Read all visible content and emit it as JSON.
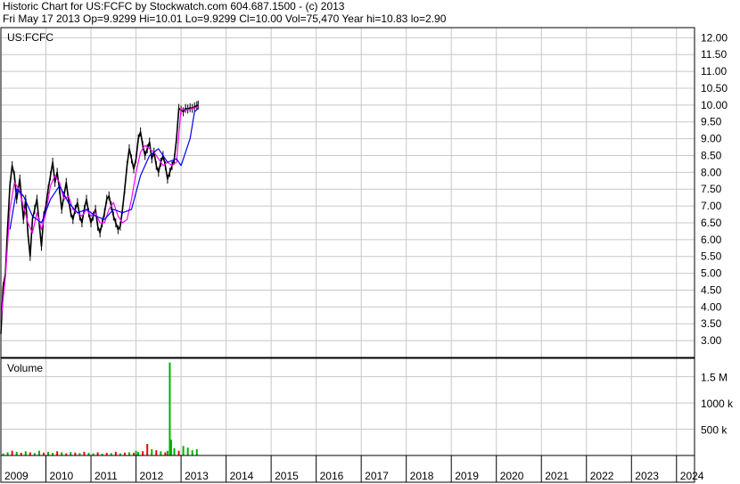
{
  "header": {
    "line1": "Historic Chart for US:FCFC by Stockwatch.com 604.687.1500 - (c) 2013",
    "line2": "Fri May 17 2013   Op=9.9299   Hi=10.01   Lo=9.9299   Cl=10.00   Vol=75,470   Year hi=10.83   lo=2.90"
  },
  "colors": {
    "price_bar": "#000000",
    "ma_short": "#ff00ff",
    "ma_long": "#0000ff",
    "volume_up": "#00b000",
    "volume_down": "#ff0000",
    "grid": "#c8c8c8"
  },
  "chart_data": [
    {
      "type": "line",
      "panel": "price",
      "title": "US:FCFC",
      "ylim": [
        2.5,
        12.3
      ],
      "y_ticks": [
        "12.00",
        "11.50",
        "11.00",
        "10.50",
        "10.00",
        "9.50",
        "9.00",
        "8.50",
        "8.00",
        "7.50",
        "7.00",
        "6.50",
        "6.00",
        "5.50",
        "5.00",
        "4.50",
        "4.00",
        "3.50",
        "3.00"
      ],
      "x_ticks": [
        "2009",
        "2010",
        "2011",
        "2012",
        "2013",
        "2014",
        "2015",
        "2016",
        "2017",
        "2018",
        "2019",
        "2020",
        "2021",
        "2022",
        "2023",
        "2024"
      ],
      "xlim": [
        2009.0,
        2024.4
      ],
      "series": [
        {
          "role": "price",
          "x": [
            2009.0,
            2009.05,
            2009.1,
            2009.15,
            2009.2,
            2009.25,
            2009.3,
            2009.35,
            2009.42,
            2009.5,
            2009.55,
            2009.6,
            2009.65,
            2009.7,
            2009.75,
            2009.8,
            2009.85,
            2009.9,
            2009.95,
            2010.0,
            2010.05,
            2010.1,
            2010.15,
            2010.2,
            2010.25,
            2010.3,
            2010.35,
            2010.4,
            2010.45,
            2010.5,
            2010.55,
            2010.6,
            2010.65,
            2010.7,
            2010.75,
            2010.8,
            2010.85,
            2010.9,
            2010.95,
            2011.0,
            2011.05,
            2011.1,
            2011.15,
            2011.2,
            2011.25,
            2011.3,
            2011.35,
            2011.4,
            2011.45,
            2011.5,
            2011.55,
            2011.6,
            2011.65,
            2011.7,
            2011.75,
            2011.8,
            2011.85,
            2011.9,
            2011.95,
            2012.0,
            2012.05,
            2012.1,
            2012.15,
            2012.2,
            2012.25,
            2012.3,
            2012.35,
            2012.4,
            2012.45,
            2012.5,
            2012.55,
            2012.6,
            2012.65,
            2012.7,
            2012.75,
            2012.8,
            2012.85,
            2012.9,
            2012.95,
            2013.0,
            2013.05,
            2013.1,
            2013.15,
            2013.2,
            2013.25,
            2013.3,
            2013.35,
            2013.38
          ],
          "y": [
            3.2,
            4.6,
            5.0,
            6.4,
            7.6,
            8.2,
            7.9,
            7.2,
            7.8,
            6.6,
            7.2,
            6.2,
            5.5,
            6.6,
            6.9,
            7.2,
            6.5,
            5.8,
            6.7,
            7.0,
            7.5,
            7.9,
            8.3,
            7.7,
            8.0,
            7.5,
            6.9,
            7.3,
            7.7,
            7.2,
            6.8,
            6.6,
            6.9,
            7.1,
            6.7,
            6.5,
            6.9,
            7.2,
            6.8,
            6.5,
            6.7,
            6.9,
            6.4,
            6.2,
            6.5,
            6.8,
            7.2,
            7.3,
            7.0,
            6.7,
            6.5,
            6.3,
            6.4,
            6.9,
            7.5,
            8.2,
            8.7,
            8.4,
            8.1,
            8.4,
            9.0,
            9.2,
            8.8,
            8.5,
            8.7,
            8.9,
            8.4,
            8.6,
            8.2,
            8.0,
            8.3,
            8.5,
            8.2,
            7.8,
            8.0,
            8.2,
            8.4,
            9.0,
            9.9,
            9.85,
            9.8,
            9.9,
            9.88,
            9.92,
            9.9,
            9.95,
            9.98,
            10.0
          ]
        },
        {
          "role": "short moving average",
          "x": [
            2009.0,
            2009.1,
            2009.2,
            2009.3,
            2009.4,
            2009.5,
            2009.6,
            2009.7,
            2009.8,
            2009.9,
            2010.0,
            2010.1,
            2010.2,
            2010.3,
            2010.4,
            2010.5,
            2010.6,
            2010.7,
            2010.8,
            2010.9,
            2011.0,
            2011.1,
            2011.2,
            2011.3,
            2011.4,
            2011.5,
            2011.6,
            2011.7,
            2011.8,
            2011.9,
            2012.0,
            2012.1,
            2012.2,
            2012.3,
            2012.4,
            2012.5,
            2012.6,
            2012.7,
            2012.8,
            2012.9,
            2013.0,
            2013.1,
            2013.2,
            2013.3,
            2013.38
          ],
          "y": [
            3.6,
            4.9,
            6.9,
            7.7,
            7.5,
            7.0,
            6.5,
            6.2,
            6.8,
            6.3,
            6.8,
            7.6,
            7.9,
            7.7,
            7.2,
            7.3,
            6.9,
            6.8,
            6.7,
            6.9,
            6.7,
            6.8,
            6.5,
            6.5,
            6.9,
            7.1,
            6.7,
            6.5,
            6.6,
            7.2,
            8.0,
            8.6,
            8.8,
            8.7,
            8.6,
            8.4,
            8.2,
            8.3,
            8.2,
            8.3,
            9.9,
            9.85,
            9.88,
            9.92,
            9.95
          ]
        },
        {
          "role": "long moving average",
          "x": [
            2009.2,
            2009.35,
            2009.5,
            2009.7,
            2009.9,
            2010.1,
            2010.3,
            2010.5,
            2010.7,
            2010.9,
            2011.1,
            2011.3,
            2011.5,
            2011.7,
            2011.9,
            2012.1,
            2012.3,
            2012.5,
            2012.7,
            2012.9,
            2013.0,
            2013.2,
            2013.3,
            2013.38
          ],
          "y": [
            6.3,
            7.5,
            7.3,
            6.7,
            6.5,
            7.2,
            7.6,
            7.1,
            6.8,
            6.9,
            6.7,
            6.6,
            6.9,
            6.8,
            6.9,
            7.9,
            8.5,
            8.7,
            8.3,
            8.4,
            8.2,
            9.0,
            9.8,
            9.9
          ]
        }
      ]
    },
    {
      "type": "bar",
      "panel": "volume",
      "title": "Volume",
      "ylim": [
        0,
        1850000
      ],
      "y_ticks": [
        {
          "label": "1.5 M",
          "value": 1500000
        },
        {
          "label": "1000 k",
          "value": 1000000
        },
        {
          "label": "500 k",
          "value": 500000
        }
      ],
      "x": [
        2009.05,
        2009.15,
        2009.25,
        2009.35,
        2009.45,
        2009.55,
        2009.65,
        2009.75,
        2009.85,
        2009.95,
        2010.05,
        2010.15,
        2010.25,
        2010.35,
        2010.45,
        2010.55,
        2010.65,
        2010.75,
        2010.85,
        2010.95,
        2011.05,
        2011.15,
        2011.25,
        2011.35,
        2011.45,
        2011.55,
        2011.65,
        2011.75,
        2011.85,
        2011.95,
        2012.0,
        2012.05,
        2012.15,
        2012.25,
        2012.35,
        2012.45,
        2012.55,
        2012.65,
        2012.7,
        2012.75,
        2012.78,
        2012.85,
        2012.95,
        2013.05,
        2013.15,
        2013.25,
        2013.35
      ],
      "values": [
        40000,
        60000,
        90000,
        70000,
        50000,
        80000,
        60000,
        45000,
        90000,
        55000,
        70000,
        50000,
        80000,
        60000,
        40000,
        65000,
        55000,
        45000,
        70000,
        50000,
        40000,
        60000,
        35000,
        50000,
        45000,
        70000,
        40000,
        55000,
        60000,
        50000,
        90000,
        65000,
        80000,
        220000,
        120000,
        100000,
        80000,
        60000,
        90000,
        1770000,
        300000,
        140000,
        90000,
        180000,
        150000,
        100000,
        120000
      ],
      "direction": [
        "up",
        "up",
        "down",
        "up",
        "down",
        "up",
        "down",
        "up",
        "up",
        "down",
        "up",
        "up",
        "down",
        "up",
        "down",
        "up",
        "down",
        "up",
        "down",
        "up",
        "up",
        "down",
        "up",
        "down",
        "up",
        "down",
        "up",
        "down",
        "up",
        "down",
        "up",
        "up",
        "down",
        "down",
        "up",
        "down",
        "up",
        "down",
        "up",
        "up",
        "up",
        "up",
        "down",
        "up",
        "up",
        "up",
        "up"
      ]
    }
  ]
}
